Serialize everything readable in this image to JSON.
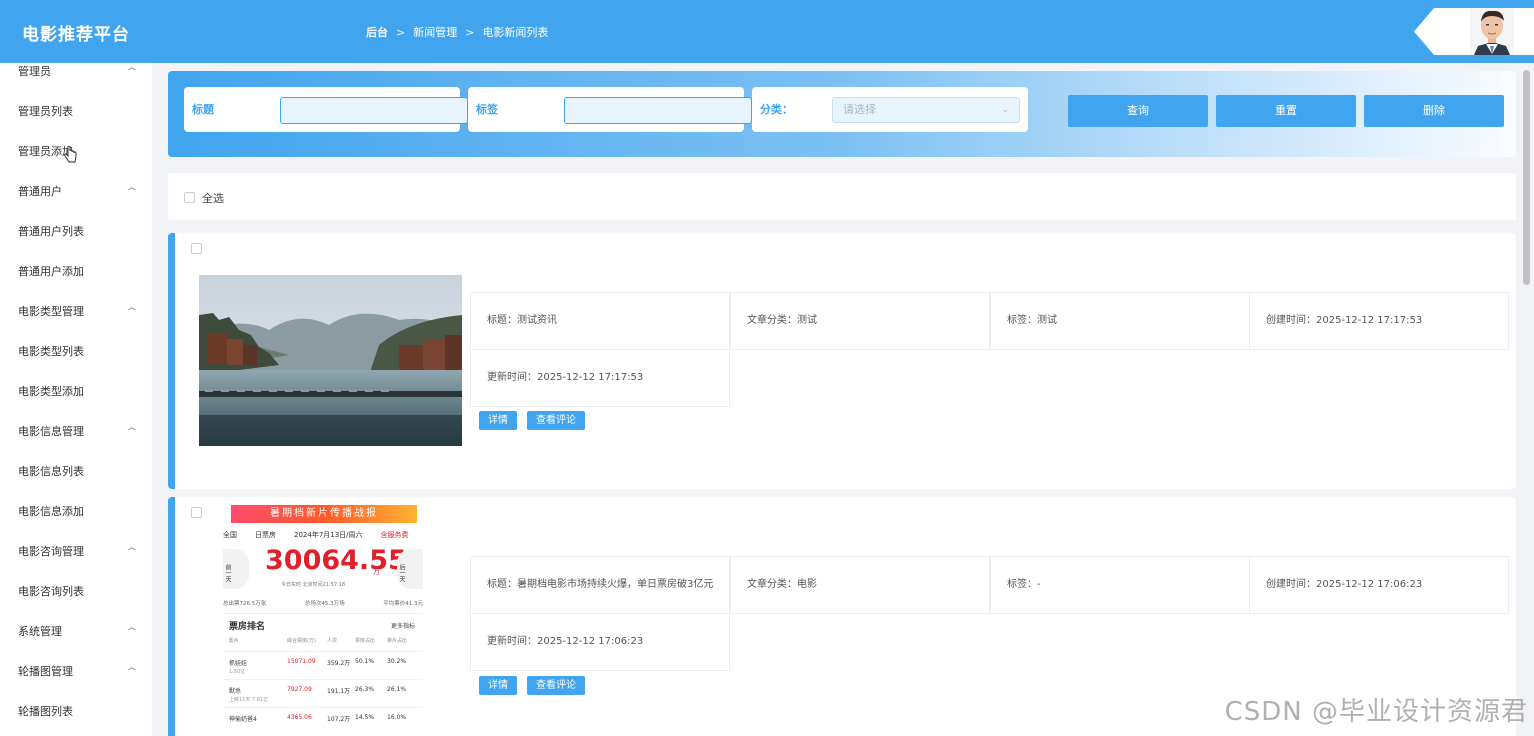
{
  "header": {
    "brand": "电影推荐平台",
    "breadcrumb": [
      "后台",
      "新闻管理",
      "电影新闻列表"
    ]
  },
  "sidebar": {
    "items": [
      {
        "label": "管理员",
        "chevron": true
      },
      {
        "label": "管理员列表",
        "chevron": false
      },
      {
        "label": "管理员添加",
        "chevron": false
      },
      {
        "label": "普通用户",
        "chevron": true
      },
      {
        "label": "普通用户列表",
        "chevron": false
      },
      {
        "label": "普通用户添加",
        "chevron": false
      },
      {
        "label": "电影类型管理",
        "chevron": true
      },
      {
        "label": "电影类型列表",
        "chevron": false
      },
      {
        "label": "电影类型添加",
        "chevron": false
      },
      {
        "label": "电影信息管理",
        "chevron": true
      },
      {
        "label": "电影信息列表",
        "chevron": false
      },
      {
        "label": "电影信息添加",
        "chevron": false
      },
      {
        "label": "电影咨询管理",
        "chevron": true
      },
      {
        "label": "电影咨询列表",
        "chevron": false
      },
      {
        "label": "系统管理",
        "chevron": true
      },
      {
        "label": "轮播图管理",
        "chevron": true
      },
      {
        "label": "轮播图列表",
        "chevron": false
      }
    ]
  },
  "search": {
    "title_label": "标题",
    "tag_label": "标签",
    "category_label": "分类：",
    "category_placeholder": "请选择",
    "buttons": {
      "query": "查询",
      "reset": "重置",
      "delete": "删除"
    }
  },
  "select_all": "全选",
  "cards": [
    {
      "title": "标题：测试资讯",
      "category": "文章分类：测试",
      "tag": "标签：测试",
      "created": "创建时间：2025-12-12 17:17:53",
      "updated": "更新时间：2025-12-12 17:17:53",
      "detail_button": "详情",
      "comments_button": "查看评论"
    },
    {
      "title": "标题：暑期档电影市场持续火爆，单日票房破3亿元",
      "category": "文章分类：电影",
      "tag": "标签：-",
      "created": "创建时间：2025-12-12 17:06:23",
      "updated": "更新时间：2025-12-12 17:06:23",
      "detail_button": "详情",
      "comments_button": "查看评论",
      "thumb": {
        "banner": "暑期档新片传播战报",
        "region": "全国",
        "filter": "日票房",
        "date": "2024年7月13日/周六",
        "live": "含服务费",
        "prev": "前一天",
        "next": "后一天",
        "amount": "30064.55",
        "amount_unit": "万",
        "realtime": "今日实时 北京时间21:57:18",
        "total": "总出票726.5万张",
        "shows": "总场次45.3万场",
        "avg": "平均票价41.3元",
        "rank_title": "票房排名",
        "more": "更多指标",
        "cols": [
          "影片",
          "综合票房(万)",
          "人次",
          "票房占比",
          "排片占比"
        ],
        "rows": [
          {
            "name": "抓娃娃",
            "sub": "1.50亿",
            "box": "15071.09",
            "people": "359.2万",
            "share": "50.1%",
            "sched": "30.2%"
          },
          {
            "name": "默杀",
            "sub": "上映11天 7.61亿",
            "box": "7927.09",
            "people": "191.1万",
            "share": "26.3%",
            "sched": "26.1%"
          },
          {
            "name": "神偷奶爸4",
            "sub": "",
            "box": "4365.06",
            "people": "107.2万",
            "share": "14.5%",
            "sched": "16.0%"
          }
        ]
      }
    }
  ],
  "watermark": "CSDN @毕业设计资源君"
}
